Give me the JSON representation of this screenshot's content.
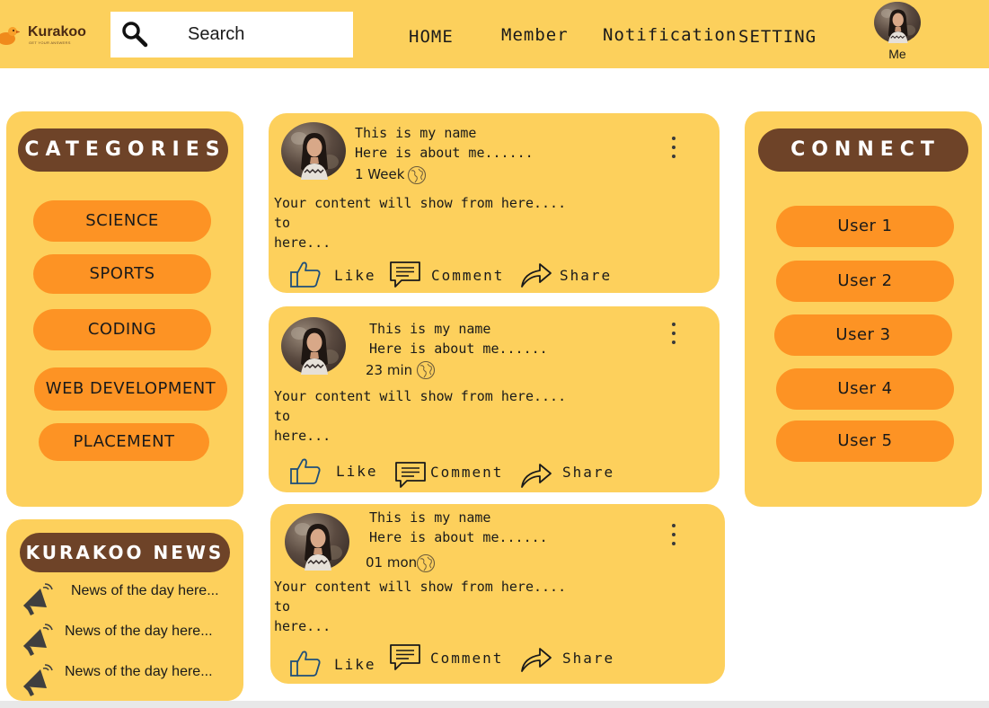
{
  "header": {
    "brand": "Kurakoo",
    "tagline": "GET YOUR ANSWERS",
    "search_placeholder": "Search",
    "nav": {
      "home": "HOME",
      "member": "Member",
      "notification": "Notification",
      "setting": "SETTING"
    },
    "me_label": "Me"
  },
  "categories": {
    "heading": "CATEGORIES",
    "items": [
      "SCIENCE",
      "SPORTS",
      "CODING",
      "WEB DEVELOPMENT",
      "PLACEMENT"
    ]
  },
  "news": {
    "heading": "KURAKOO NEWS",
    "items": [
      "News of the day here...",
      "News of the day here...",
      "News of the day here..."
    ]
  },
  "posts": [
    {
      "name": "This is my name",
      "about": "Here is about me......",
      "time": "1 Week",
      "content": [
        "Your content will show from here....",
        "to",
        "here..."
      ]
    },
    {
      "name": "This is my name",
      "about": "Here is about me......",
      "time": "23 min",
      "content": [
        "Your content will show from here....",
        "to",
        "here..."
      ]
    },
    {
      "name": "This is my name",
      "about": "Here is about me......",
      "time": "01 mon",
      "content": [
        "Your content will show from here....",
        "to",
        "here..."
      ]
    }
  ],
  "actions": {
    "like": "Like",
    "comment": "Comment",
    "share": "Share"
  },
  "connect": {
    "heading": "CONNECT",
    "users": [
      "User 1",
      "User 2",
      "User 3",
      "User 4",
      "User 5"
    ]
  },
  "colors": {
    "header_bg": "#fcd05c",
    "panel_bg": "#fdd05c",
    "pill_bg": "#fd9324",
    "heading_bg": "#6e4328"
  },
  "icons": [
    "search-icon",
    "duck-logo-icon",
    "avatar",
    "kebab-menu-icon",
    "globe-icon",
    "like-icon",
    "comment-icon",
    "share-icon",
    "megaphone-icon"
  ]
}
